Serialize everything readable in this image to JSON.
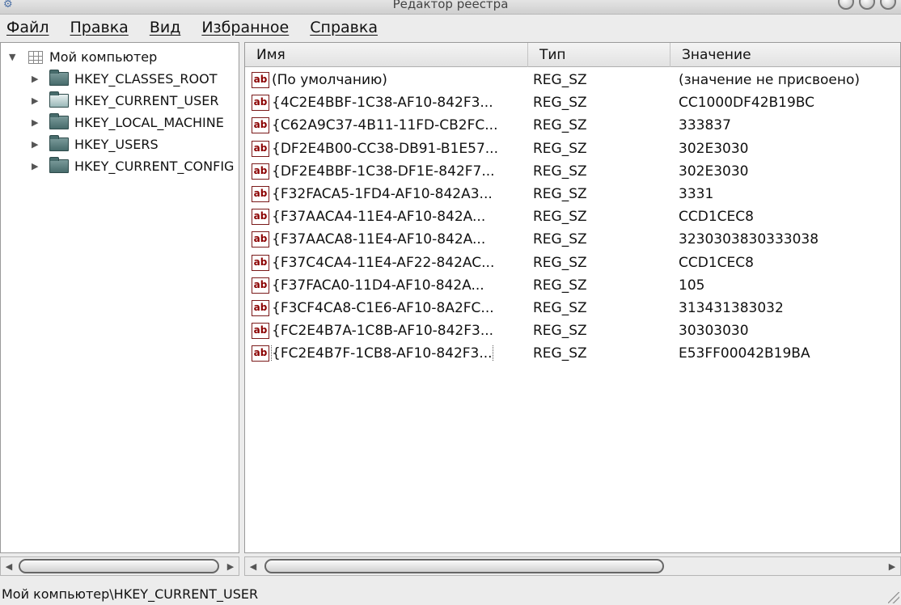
{
  "window": {
    "title": "Редактор реестра"
  },
  "menu": [
    "Файл",
    "Правка",
    "Вид",
    "Избранное",
    "Справка"
  ],
  "tree": {
    "root": "Мой компьютер",
    "children": [
      "HKEY_CLASSES_ROOT",
      "HKEY_CURRENT_USER",
      "HKEY_LOCAL_MACHINE",
      "HKEY_USERS",
      "HKEY_CURRENT_CONFIG"
    ]
  },
  "list": {
    "columns": {
      "name": "Имя",
      "type": "Тип",
      "value": "Значение"
    },
    "icon_text": "ab",
    "rows": [
      {
        "name": "(По умолчанию)",
        "type": "REG_SZ",
        "value": "(значение не присвоено)"
      },
      {
        "name": "{4C2E4BBF-1C38-AF10-842F3...",
        "type": "REG_SZ",
        "value": "CC1000DF42B19BC"
      },
      {
        "name": "{C62A9C37-4B11-11FD-CB2FC...",
        "type": "REG_SZ",
        "value": "333837"
      },
      {
        "name": "{DF2E4B00-CC38-DB91-B1E57...",
        "type": "REG_SZ",
        "value": "302E3030"
      },
      {
        "name": "{DF2E4BBF-1C38-DF1E-842F7...",
        "type": "REG_SZ",
        "value": "302E3030"
      },
      {
        "name": "{F32FACA5-1FD4-AF10-842A3...",
        "type": "REG_SZ",
        "value": "3331"
      },
      {
        "name": "{F37AACA4-11E4-AF10-842A...",
        "type": "REG_SZ",
        "value": "CCD1CEC8"
      },
      {
        "name": "{F37AACA8-11E4-AF10-842A...",
        "type": "REG_SZ",
        "value": "3230303830333038"
      },
      {
        "name": "{F37C4CA4-11E4-AF22-842AC...",
        "type": "REG_SZ",
        "value": "CCD1CEC8"
      },
      {
        "name": "{F37FACA0-11D4-AF10-842A...",
        "type": "REG_SZ",
        "value": "105"
      },
      {
        "name": "{F3CF4CA8-C1E6-AF10-8A2FC...",
        "type": "REG_SZ",
        "value": "313431383032"
      },
      {
        "name": "{FC2E4B7A-1C8B-AF10-842F3...",
        "type": "REG_SZ",
        "value": "30303030"
      },
      {
        "name": "{FC2E4B7F-1CB8-AF10-842F3...",
        "type": "REG_SZ",
        "value": "E53FF00042B19BA"
      }
    ]
  },
  "status": {
    "path": "Мой компьютер\\HKEY_CURRENT_USER"
  },
  "colors": {
    "window_bg": "#ececec",
    "icon_accent": "#8b0000",
    "folder": "#476b6b"
  }
}
